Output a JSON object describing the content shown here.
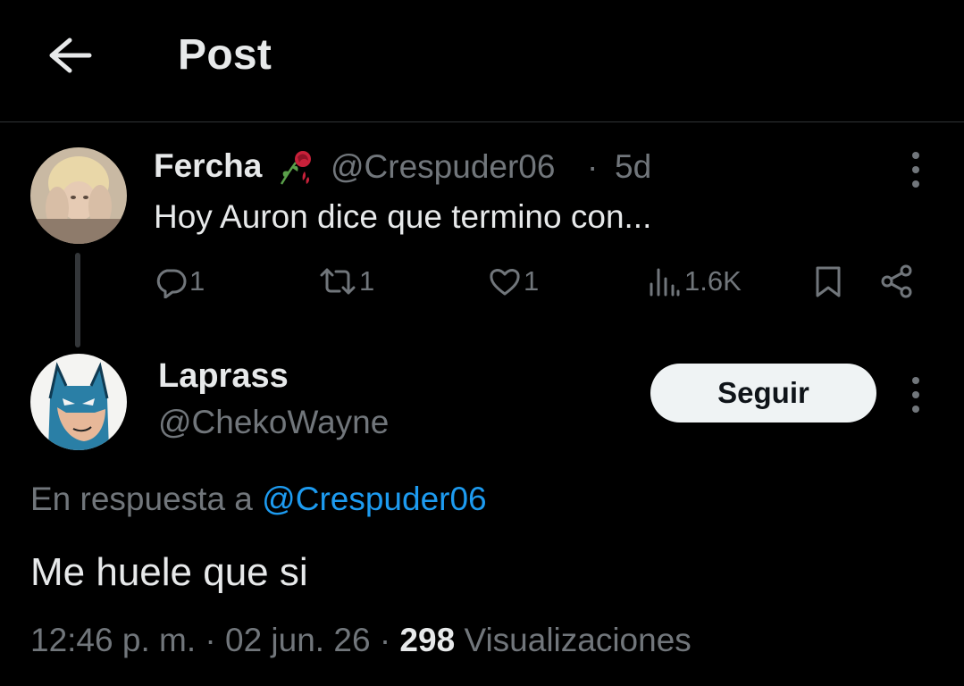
{
  "header": {
    "title": "Post",
    "back_icon": "arrow-left-icon"
  },
  "parent_post": {
    "author_name": "Fercha",
    "author_emoji": "wilted-rose-icon",
    "handle": "@Crespuder06",
    "separator": "·",
    "time": "5d",
    "text": "Hoy Auron dice que termino con...",
    "stats": {
      "replies": "1",
      "reposts": "1",
      "likes": "1",
      "views": "1.6K"
    }
  },
  "reply_post": {
    "author_name": "Laprass",
    "handle": "@ChekoWayne",
    "follow_label": "Seguir",
    "reply_to_prefix": "En respuesta a",
    "reply_to_mention": "@Crespuder06",
    "text": "Me huele que si",
    "time": "12:46 p. m.",
    "sep1": "·",
    "date": "02 jun. 26",
    "sep2": "·",
    "views_count": "298",
    "views_label": "Visualizaciones"
  },
  "colors": {
    "background": "#000000",
    "primary_text": "#e7e9ea",
    "secondary_text": "#71767b",
    "accent": "#1d9bf0",
    "button_bg": "#eff3f4"
  }
}
